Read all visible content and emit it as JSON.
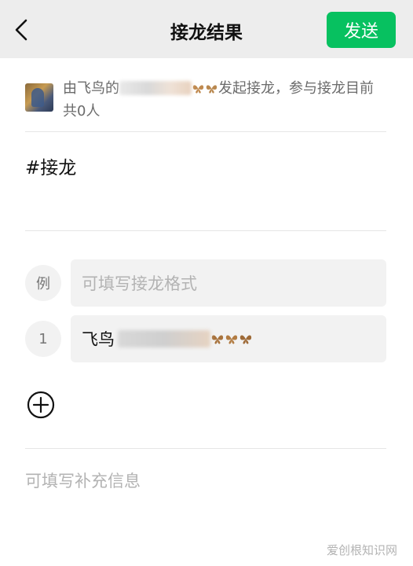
{
  "header": {
    "back_icon": "chevron-left-icon",
    "title": "接龙结果",
    "send_label": "发送",
    "send_color": "#07c160"
  },
  "info": {
    "prefix": "由飞鸟的",
    "suffix": "发起接龙，参与接龙目前共0人"
  },
  "topic": "#接龙",
  "rows": [
    {
      "badge": "例",
      "placeholder": "可填写接龙格式"
    },
    {
      "badge": "1",
      "value_prefix": "飞鸟"
    }
  ],
  "add_icon": "plus-circle-icon",
  "supplement_placeholder": "可填写补充信息",
  "watermark": "爱创根知识网"
}
